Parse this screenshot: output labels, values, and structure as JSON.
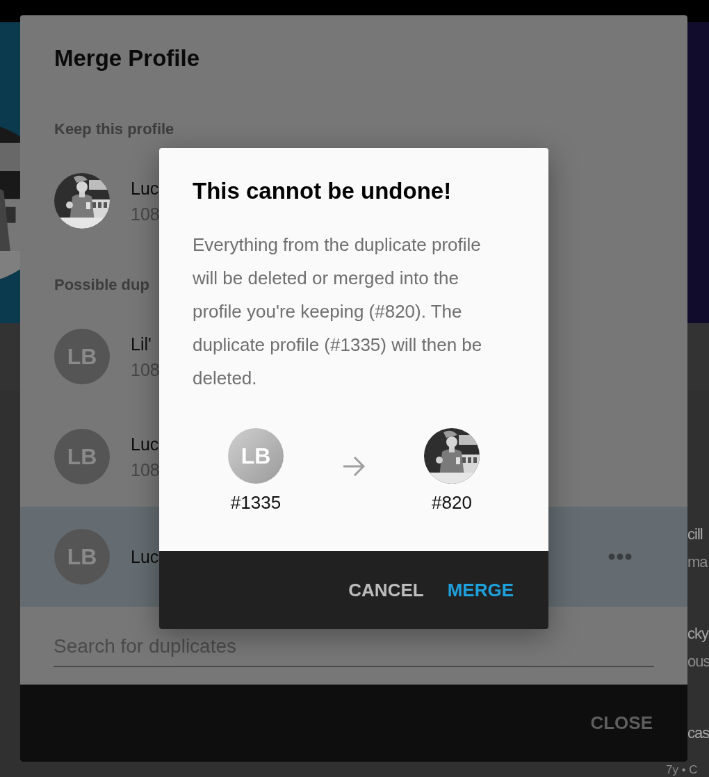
{
  "background": {
    "list": [
      {
        "name": "cill",
        "detail": "ma"
      },
      {
        "name": "cky",
        "detail": "ous"
      },
      {
        "name": "cas",
        "detail": "7y • C"
      }
    ]
  },
  "merge_dialog": {
    "title": "Merge Profile",
    "keep_heading": "Keep this profile",
    "keep_profile": {
      "name": "Luc",
      "detail": "108"
    },
    "duplicates_heading": "Possible dup",
    "duplicates": [
      {
        "avatar": {
          "kind": "initials",
          "initials": "LB"
        },
        "name": "Lil'",
        "detail": "108",
        "selected": false
      },
      {
        "avatar": {
          "kind": "initials",
          "initials": "LB"
        },
        "name": "Luc",
        "detail": "108",
        "selected": false
      },
      {
        "avatar": {
          "kind": "initials",
          "initials": "LB"
        },
        "name": "Luc",
        "selected": true
      }
    ],
    "search": {
      "placeholder": "Search for duplicates"
    },
    "buttons": [
      "CLOSE"
    ]
  },
  "confirm_dialog": {
    "title": "This cannot be undone!",
    "message": "Everything from the duplicate profile will be deleted or merged into the profile you're keeping (#820). The duplicate profile (#1335) will then be deleted.",
    "from": {
      "avatar": {
        "kind": "initials",
        "initials": "LB"
      },
      "label": "#1335"
    },
    "to": {
      "label": "#820"
    },
    "buttons": [
      {
        "label": "CANCEL",
        "kind": "secondary"
      },
      {
        "label": "MERGE",
        "kind": "primary"
      }
    ]
  }
}
